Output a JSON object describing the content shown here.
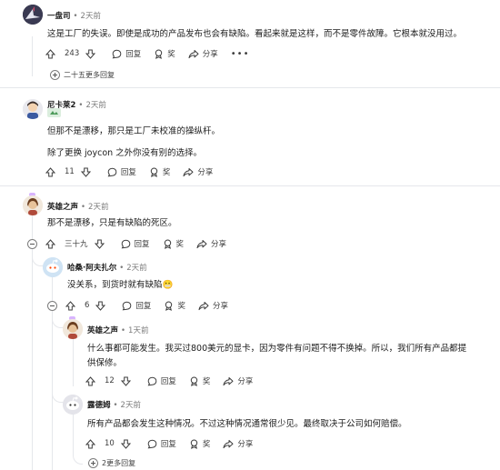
{
  "comments": [
    {
      "author": "一盘司",
      "time": "2天前",
      "lines": [
        "这是工厂的失误。即使是成功的产品发布也会有缺陷。看起来就是这样，而不是零件故障。它根本就没用过。"
      ],
      "votes": "243",
      "reply": "回复",
      "award": "奖",
      "share": "分享",
      "more_replies": "二十五更多回复"
    },
    {
      "author": "尼卡莱2",
      "time": "2天前",
      "lines": [
        "但那不是漂移，那只是工厂未校准的操纵杆。",
        "除了更换 joycon 之外你没有别的选择。"
      ],
      "votes": "11",
      "reply": "回复",
      "award": "奖",
      "share": "分享"
    },
    {
      "author": "英雄之声",
      "time": "2天前",
      "lines": [
        "那不是漂移，只是有缺陷的死区。"
      ],
      "votes": "三十九",
      "reply": "回复",
      "award": "奖",
      "share": "分享"
    },
    {
      "author": "哈桑·阿夫扎尔",
      "time": "2天前",
      "lines": [
        "没关系，到货时就有缺陷😬"
      ],
      "votes": "6",
      "reply": "回复",
      "award": "奖",
      "share": "分享"
    },
    {
      "author": "英雄之声",
      "time": "1天前",
      "lines": [
        "什么事都可能发生。我买过800美元的显卡，因为零件有问题不得不换掉。所以，我们所有产品都提",
        "供保修。"
      ],
      "votes": "12",
      "reply": "回复",
      "award": "奖",
      "share": "分享"
    },
    {
      "author": "露德姆",
      "time": "2天前",
      "lines": [
        "所有产品都会发生这种情况。不过这种情况通常很少见。最终取决于公司如何赔偿。"
      ],
      "votes": "10",
      "reply": "回复",
      "award": "奖",
      "share": "分享",
      "more_replies": "2更多回复"
    }
  ],
  "dot": "•",
  "more_menu": "•••",
  "colors": {
    "accent_badge": "#d8b4fe",
    "thread_line": "#e5e7eb",
    "text": "#1c1c1c",
    "muted": "#7c7c7c"
  }
}
